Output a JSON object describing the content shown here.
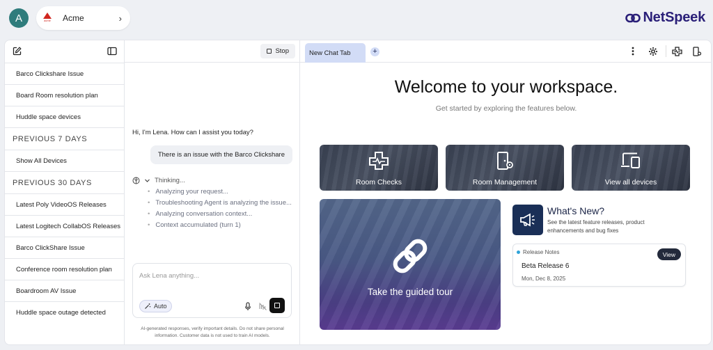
{
  "header": {
    "avatar_initial": "A",
    "org_name": "Acme",
    "org_logo_text": "acme",
    "brand": "NetSpeek"
  },
  "sidebar": {
    "items_top": [
      {
        "label": "Barco Clickshare Issue"
      },
      {
        "label": "Board Room resolution plan"
      },
      {
        "label": "Huddle space devices"
      }
    ],
    "section_7": "PREVIOUS 7 DAYS",
    "items_7": [
      {
        "label": "Show All Devices"
      }
    ],
    "section_30": "PREVIOUS 30 DAYS",
    "items_30": [
      {
        "label": "Latest Poly VideoOS Releases"
      },
      {
        "label": "Latest Logitech CollabOS Releases"
      },
      {
        "label": "Barco ClickShare Issue"
      },
      {
        "label": "Conference room resolution plan"
      },
      {
        "label": "Boardroom AV Issue"
      },
      {
        "label": "Huddle space outage detected"
      }
    ]
  },
  "chat": {
    "stop_label": "Stop",
    "greeting": "Hi, I'm Lena. How can I assist you today?",
    "user_message": "There is an issue with the Barco Clickshare",
    "thinking_label": "Thinking...",
    "steps": [
      "Analyzing your request...",
      "Troubleshooting Agent is analyzing the issue...",
      "Analyzing conversation context...",
      "Context accumulated (turn 1)"
    ],
    "input_placeholder": "Ask Lena anything...",
    "auto_label": "Auto",
    "disclaimer": "AI-generated responses, verify important details. Do not share personal information. Customer data is not used to train AI models."
  },
  "workspace": {
    "tab_label": "New Chat Tab",
    "title": "Welcome to your workspace.",
    "subtitle": "Get started by exploring the features below.",
    "cards": [
      {
        "label": "Room Checks",
        "icon": "room-checks-icon"
      },
      {
        "label": "Room Management",
        "icon": "room-management-icon"
      },
      {
        "label": "View all devices",
        "icon": "devices-icon"
      }
    ],
    "tour_label": "Take the guided tour",
    "whats_new": {
      "title": "What's New?",
      "description": "See the latest feature releases, product enhancements and bug fixes",
      "release_label": "Release Notes",
      "release_name": "Beta Release 6",
      "release_date": "Mon, Dec 8, 2025",
      "view_label": "View"
    }
  },
  "colors": {
    "brand": "#2a1f78",
    "tab_active": "#d2dcf6",
    "avatar": "#2f7c7c"
  }
}
